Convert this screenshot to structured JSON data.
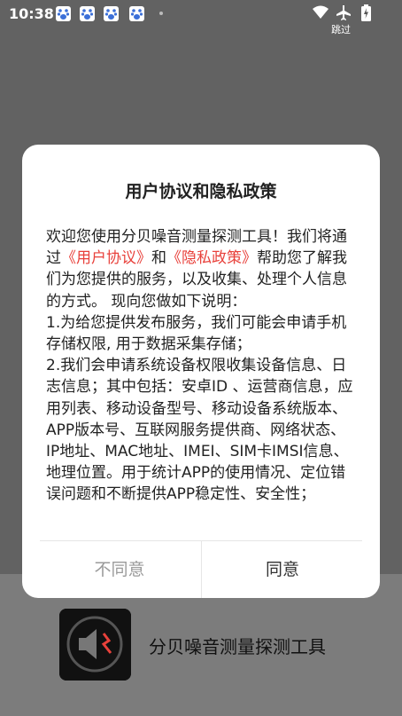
{
  "status_bar": {
    "time": "10:38",
    "notification_icons": [
      "baidu-icon",
      "baidu-icon",
      "baidu-icon",
      "baidu-icon"
    ],
    "right_icons": [
      "wifi-icon",
      "airplane-icon",
      "battery-charging-icon"
    ],
    "skip_label": "跳过"
  },
  "dialog": {
    "title": "用户协议和隐私政策",
    "intro_prefix": "欢迎您使用分贝噪音测量探测工具！我们将通过",
    "user_agreement_link": "《用户协议》",
    "intro_and": "和",
    "privacy_policy_link": "《隐私政策》",
    "intro_suffix": "帮助您了解我们为您提供的服务，以及收集、处理个人信息的方式。 现向您做如下说明：",
    "item1": "1.为给您提供发布服务，我们可能会申请手机存储权限, 用于数据采集存储；",
    "item2": "2.我们会申请系统设备权限收集设备信息、日志信息；其中包括：安卓ID 、运营商信息，应用列表、移动设备型号、移动设备系统版本、APP版本号、互联网服务提供商、网络状态、IP地址、MAC地址、IMEI、SIM卡IMSI信息、地理位置。用于统计APP的使用情况、定位错误问题和不断提供APP稳定性、安全性；",
    "disagree_label": "不同意",
    "agree_label": "同意"
  },
  "app": {
    "name": "分贝噪音测量探测工具"
  },
  "colors": {
    "link": "#e8413b",
    "overlay": "#626262",
    "dialog_bg": "#ffffff"
  }
}
